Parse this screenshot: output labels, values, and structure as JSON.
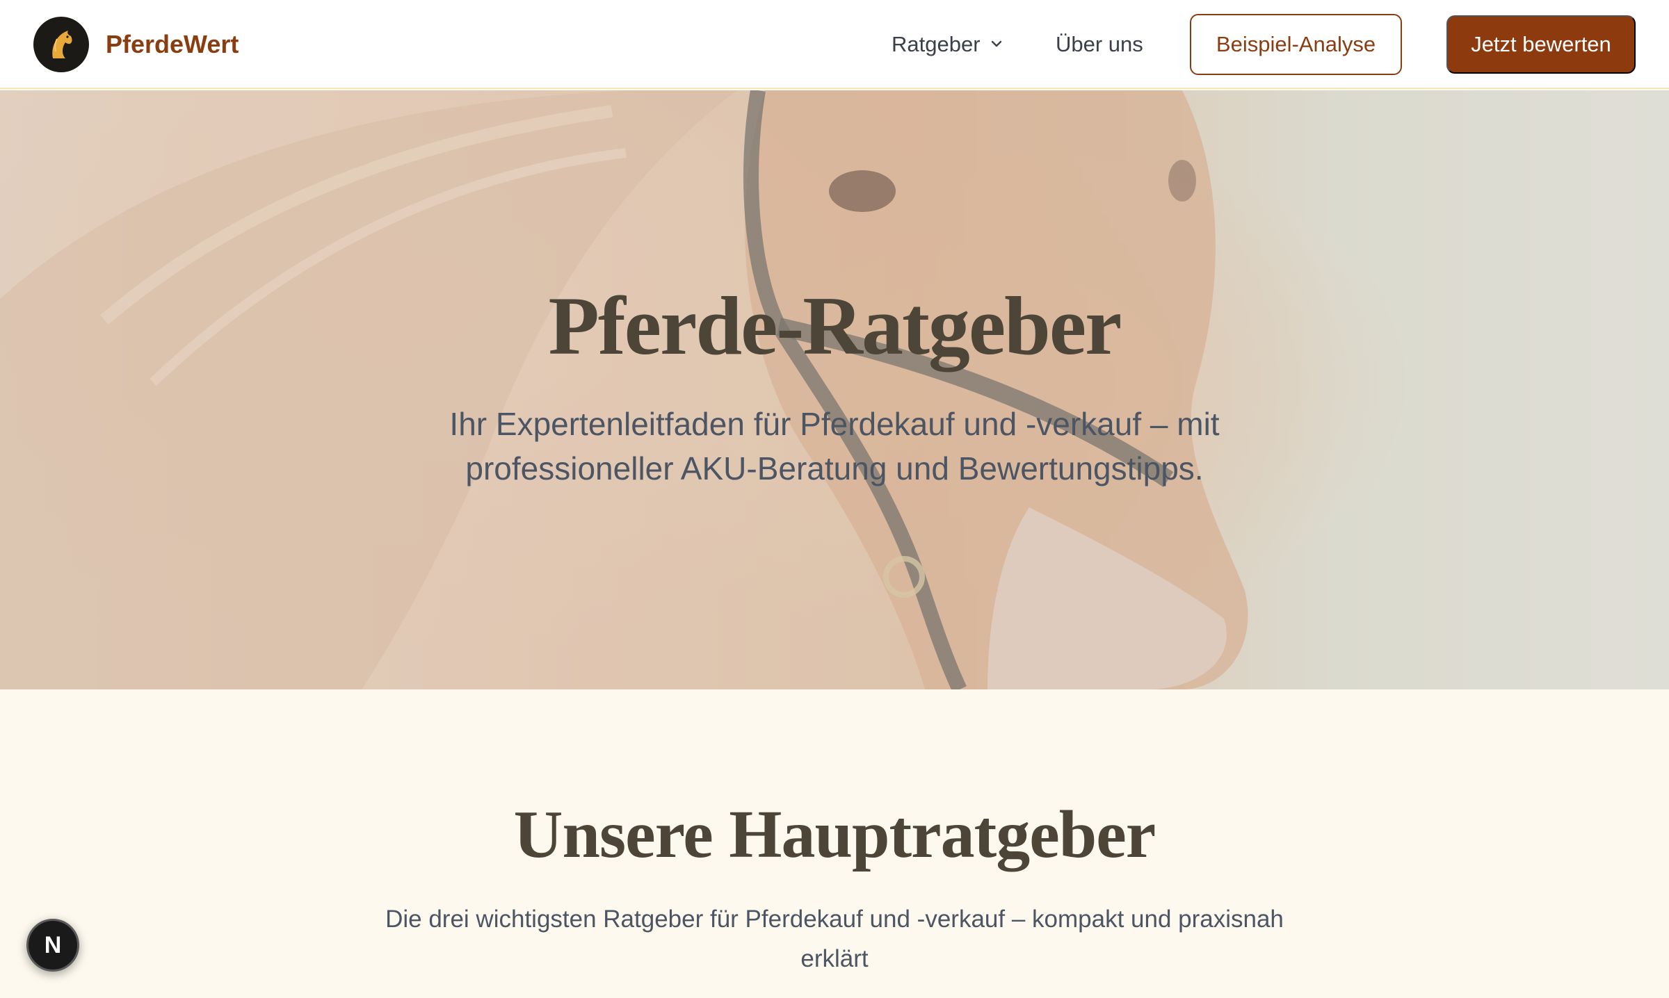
{
  "header": {
    "brand": "PferdeWert",
    "nav": {
      "ratgeber_label": "Ratgeber",
      "ueber_label": "Über uns"
    },
    "buttons": {
      "example_label": "Beispiel-Analyse",
      "cta_label": "Jetzt bewerten"
    }
  },
  "hero": {
    "title": "Pferde-Ratgeber",
    "subtitle": "Ihr Expertenleitfaden für Pferdekauf und -verkauf – mit professioneller AKU-Beratung und Bewertungstipps."
  },
  "section": {
    "title": "Unsere Hauptratgeber",
    "subtitle": "Die drei wichtigsten Ratgeber für Pferdekauf und -verkauf – kompakt und praxisnah erklärt"
  },
  "floating_badge": {
    "letter": "N"
  },
  "colors": {
    "brand": "#8b3d12",
    "cta_background": "#8d3a0e",
    "heading": "#4d4538",
    "body_text": "#4b5563",
    "page_background": "#fdf9ee"
  },
  "icons": {
    "logo": "horse-head-icon",
    "dropdown": "chevron-down-icon"
  }
}
